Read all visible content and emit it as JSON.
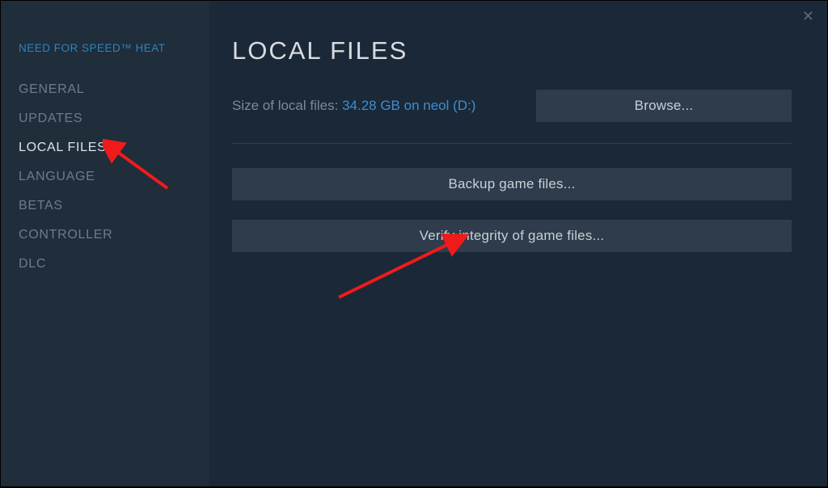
{
  "sidebar": {
    "game_title": "NEED FOR SPEED™ HEAT",
    "items": [
      {
        "label": "GENERAL",
        "active": false
      },
      {
        "label": "UPDATES",
        "active": false
      },
      {
        "label": "LOCAL FILES",
        "active": true
      },
      {
        "label": "LANGUAGE",
        "active": false
      },
      {
        "label": "BETAS",
        "active": false
      },
      {
        "label": "CONTROLLER",
        "active": false
      },
      {
        "label": "DLC",
        "active": false
      }
    ]
  },
  "content": {
    "page_title": "LOCAL FILES",
    "size_label": "Size of local files: ",
    "size_value": "34.28 GB on neol (D:)",
    "browse_button": "Browse...",
    "backup_button": "Backup game files...",
    "verify_button": "Verify integrity of game files..."
  },
  "close_glyph": "✕"
}
